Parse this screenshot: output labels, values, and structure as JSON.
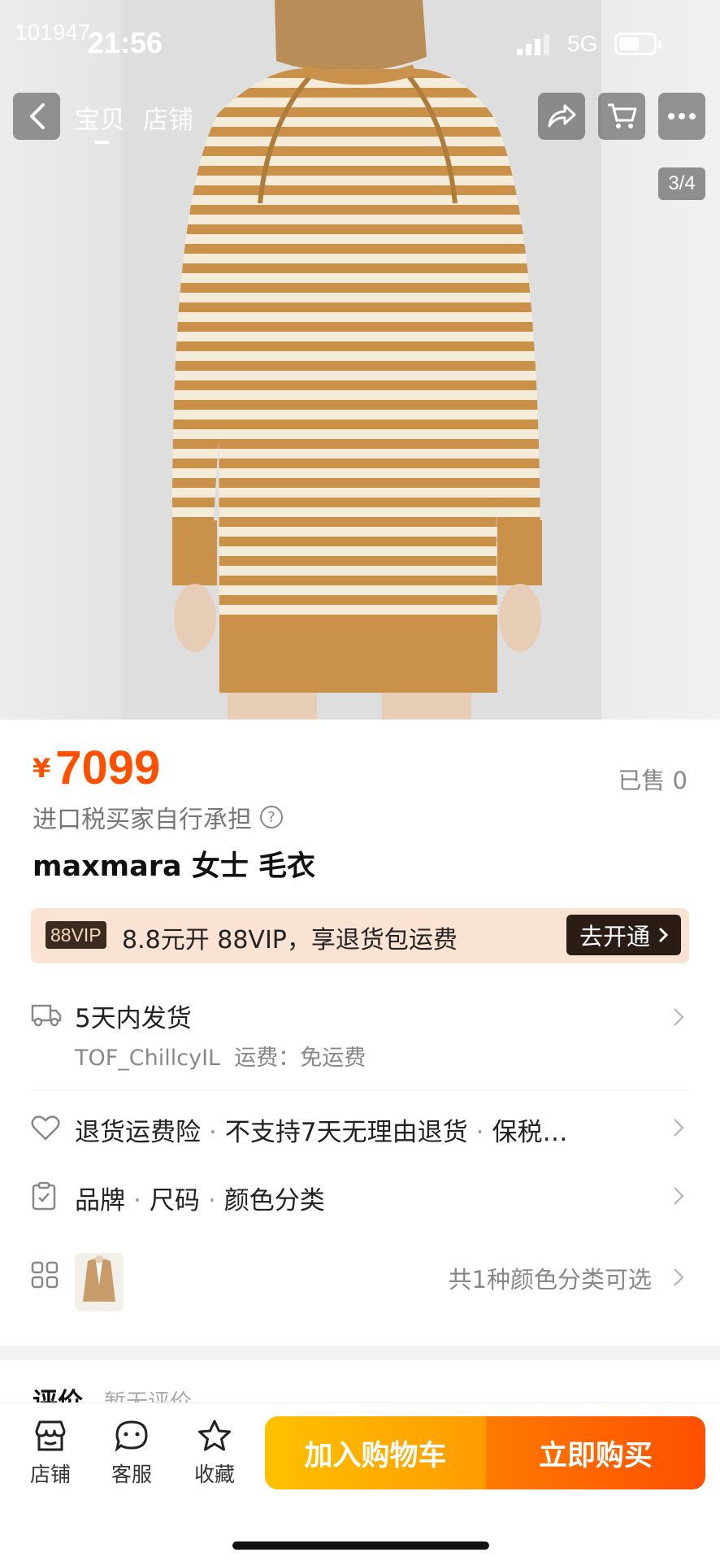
{
  "status_bar": {
    "id_text": "101947",
    "time": "21:56",
    "network": "5G"
  },
  "nav": {
    "tab_item": "宝贝",
    "tab_shop": "店铺",
    "page_indicator": "3/4"
  },
  "product": {
    "price_symbol": "¥",
    "price": "7099",
    "sold": "已售 0",
    "tax_note": "进口税买家自行承担",
    "title": "maxmara 女士 毛衣"
  },
  "vip": {
    "badge": "88VIP",
    "text": "8.8元开 88VIP，享退货包运费",
    "cta": "去开通"
  },
  "shipping": {
    "delivery": "5天内发货",
    "sender": "TOF_ChillcyIL",
    "fee": "运费：免运费"
  },
  "service": {
    "items": [
      "退货运费险",
      "不支持7天无理由退货",
      "保税…"
    ]
  },
  "params": {
    "items": [
      "品牌",
      "尺码",
      "颜色分类"
    ]
  },
  "variants": {
    "text": "共1种颜色分类可选"
  },
  "reviews": {
    "title": "评价",
    "subtitle": "暂无评价"
  },
  "bottom_bar": {
    "tabs": [
      {
        "label": "店铺",
        "icon": "shop-icon"
      },
      {
        "label": "客服",
        "icon": "service-icon"
      },
      {
        "label": "收藏",
        "icon": "star-icon"
      }
    ],
    "add_to_cart": "加入购物车",
    "buy_now": "立即购买"
  },
  "colors": {
    "accent": "#ff5000",
    "cart_btn": "#ffb000",
    "buy_btn": "#ff5a00",
    "stripe_tan": "#c9914a",
    "stripe_cream": "#f4ecd9"
  }
}
